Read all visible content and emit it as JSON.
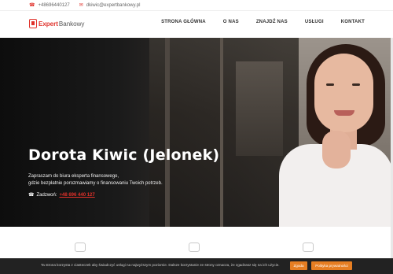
{
  "topbar": {
    "phone": "+48696440127",
    "email": "dkiwic@expertbankowy.pl",
    "phone_icon": "phone-icon",
    "email_icon": "envelope-icon"
  },
  "logo": {
    "part_a": "Expert",
    "part_b": "Bankowy"
  },
  "nav": {
    "items": [
      "STRONA GŁÓWNA",
      "O NAS",
      "ZNAJDŹ NAS",
      "USŁUGI",
      "KONTAKT"
    ]
  },
  "hero": {
    "title": "Dorota Kiwic (Jelonek)",
    "line1": "Zapraszam do biura eksperta finansowego,",
    "line2": "gdzie bezpłatnie porozmawiamy o finansowaniu Twoich potrzeb.",
    "call_label": "Zadzwoń:",
    "call_number": "+48 696 440 127"
  },
  "cookie": {
    "text": "Ta strona korzysta z ciasteczek aby świadczyć usługi na najwyższym poziomie. Dalsze korzystanie ze strony oznacza, że zgadzasz się na ich użycie.",
    "accept_label": "Zgoda",
    "policy_label": "Polityka prywatności"
  },
  "colors": {
    "accent": "#e0312a",
    "cookie_button": "#e67e22",
    "cookie_bar": "#222222"
  }
}
